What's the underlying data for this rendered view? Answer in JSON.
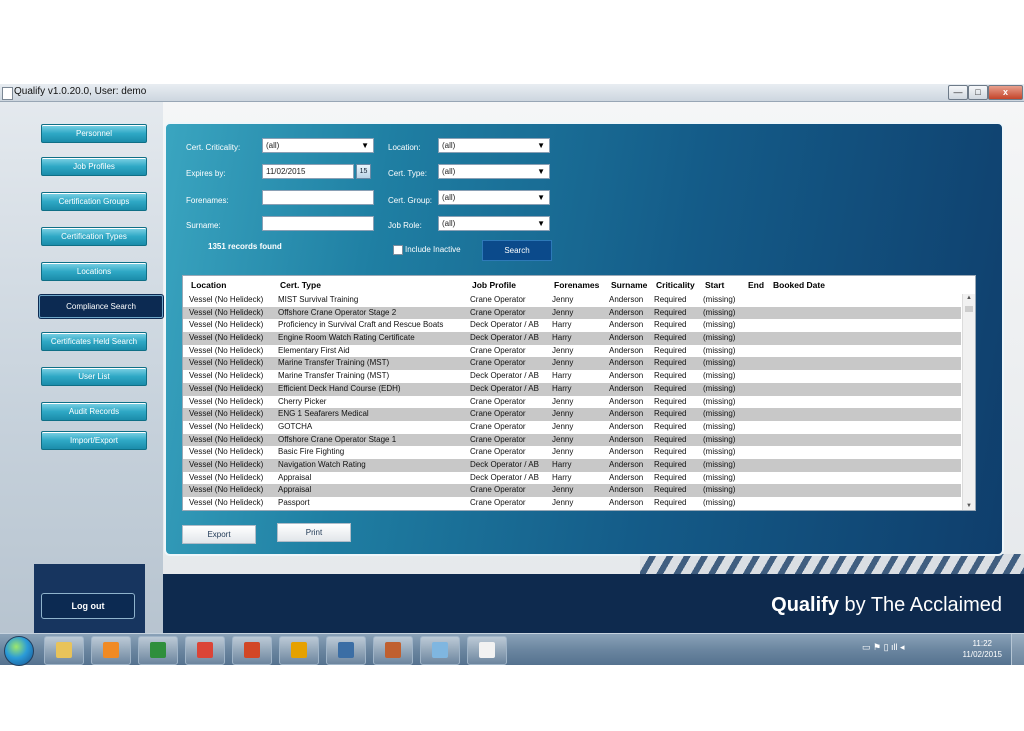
{
  "window": {
    "title": "Qualify v1.0.20.0, User: demo",
    "min": "—",
    "max": "□",
    "close": "x"
  },
  "sidebar": {
    "items": [
      {
        "label": "Personnel"
      },
      {
        "label": "Job Profiles"
      },
      {
        "label": "Certification Groups"
      },
      {
        "label": "Certification Types"
      },
      {
        "label": "Locations"
      },
      {
        "label": "Compliance Search"
      },
      {
        "label": "Certificates Held Search"
      },
      {
        "label": "User List"
      },
      {
        "label": "Audit Records"
      },
      {
        "label": "Import/Export"
      }
    ],
    "active_item": "Compliance Search",
    "logout_label": "Log out"
  },
  "filters": {
    "cert_criticality": {
      "label": "Cert. Criticality:",
      "value": "(all)"
    },
    "expires_by": {
      "label": "Expires by:",
      "value": "11/02/2015",
      "calendar": "15"
    },
    "forenames": {
      "label": "Forenames:",
      "value": ""
    },
    "surname": {
      "label": "Surname:",
      "value": ""
    },
    "location": {
      "label": "Location:",
      "value": "(all)"
    },
    "cert_type": {
      "label": "Cert. Type:",
      "value": "(all)"
    },
    "cert_group": {
      "label": "Cert. Group:",
      "value": "(all)"
    },
    "job_role": {
      "label": "Job Role:",
      "value": "(all)"
    },
    "include_inactive": {
      "label": "Include Inactive",
      "checked": false
    },
    "search_label": "Search",
    "records_found": "1351 records found"
  },
  "grid": {
    "columns": [
      "Location",
      "Cert. Type",
      "Job Profile",
      "Forenames",
      "Surname",
      "Criticality",
      "Start",
      "End",
      "Booked Date"
    ],
    "rows": [
      [
        "Vessel (No Helideck)",
        "MIST Survival Training",
        "Crane Operator",
        "Jenny",
        "Anderson",
        "Required",
        "(missing)"
      ],
      [
        "Vessel (No Helideck)",
        "Offshore Crane Operator Stage 2",
        "Crane Operator",
        "Jenny",
        "Anderson",
        "Required",
        "(missing)"
      ],
      [
        "Vessel (No Helideck)",
        "Proficiency in Survival Craft and Rescue Boats",
        "Deck Operator / AB",
        "Harry",
        "Anderson",
        "Required",
        "(missing)"
      ],
      [
        "Vessel (No Helideck)",
        "Engine Room Watch Rating Certificate",
        "Deck Operator / AB",
        "Harry",
        "Anderson",
        "Required",
        "(missing)"
      ],
      [
        "Vessel (No Helideck)",
        "Elementary First Aid",
        "Crane Operator",
        "Jenny",
        "Anderson",
        "Required",
        "(missing)"
      ],
      [
        "Vessel (No Helideck)",
        "Marine Transfer Training (MST)",
        "Crane Operator",
        "Jenny",
        "Anderson",
        "Required",
        "(missing)"
      ],
      [
        "Vessel (No Helideck)",
        "Marine Transfer Training (MST)",
        "Deck Operator / AB",
        "Harry",
        "Anderson",
        "Required",
        "(missing)"
      ],
      [
        "Vessel (No Helideck)",
        "Efficient Deck Hand Course (EDH)",
        "Deck Operator / AB",
        "Harry",
        "Anderson",
        "Required",
        "(missing)"
      ],
      [
        "Vessel (No Helideck)",
        "Cherry Picker",
        "Crane Operator",
        "Jenny",
        "Anderson",
        "Required",
        "(missing)"
      ],
      [
        "Vessel (No Helideck)",
        "ENG 1 Seafarers Medical",
        "Crane Operator",
        "Jenny",
        "Anderson",
        "Required",
        "(missing)"
      ],
      [
        "Vessel (No Helideck)",
        "GOTCHA",
        "Crane Operator",
        "Jenny",
        "Anderson",
        "Required",
        "(missing)"
      ],
      [
        "Vessel (No Helideck)",
        "Offshore Crane Operator Stage 1",
        "Crane Operator",
        "Jenny",
        "Anderson",
        "Required",
        "(missing)"
      ],
      [
        "Vessel (No Helideck)",
        "Basic Fire Fighting",
        "Crane Operator",
        "Jenny",
        "Anderson",
        "Required",
        "(missing)"
      ],
      [
        "Vessel (No Helideck)",
        "Navigation Watch Rating",
        "Deck Operator / AB",
        "Harry",
        "Anderson",
        "Required",
        "(missing)"
      ],
      [
        "Vessel (No Helideck)",
        "Appraisal",
        "Deck Operator / AB",
        "Harry",
        "Anderson",
        "Required",
        "(missing)"
      ],
      [
        "Vessel (No Helideck)",
        "Appraisal",
        "Crane Operator",
        "Jenny",
        "Anderson",
        "Required",
        "(missing)"
      ],
      [
        "Vessel (No Helideck)",
        "Passport",
        "Crane Operator",
        "Jenny",
        "Anderson",
        "Required",
        "(missing)"
      ]
    ]
  },
  "actions": {
    "export_label": "Export",
    "print_label": "Print"
  },
  "brand": {
    "bold": "Qualify",
    "rest": " by The Acclaimed"
  },
  "taskbar": {
    "icons": [
      "explorer-icon",
      "media-player-icon",
      "excel-icon",
      "chrome-icon",
      "powerpoint-icon",
      "outlook-icon",
      "window-icon",
      "app-icon",
      "paint-icon",
      "document-icon"
    ],
    "tray_glyphs": "▭ ⚑ ▯ ıll ◂",
    "time": "11:22",
    "date": "11/02/2015"
  },
  "colors": {
    "accent": "#2ea8c5",
    "navy": "#0e2a4e",
    "panel": "#145b88"
  }
}
